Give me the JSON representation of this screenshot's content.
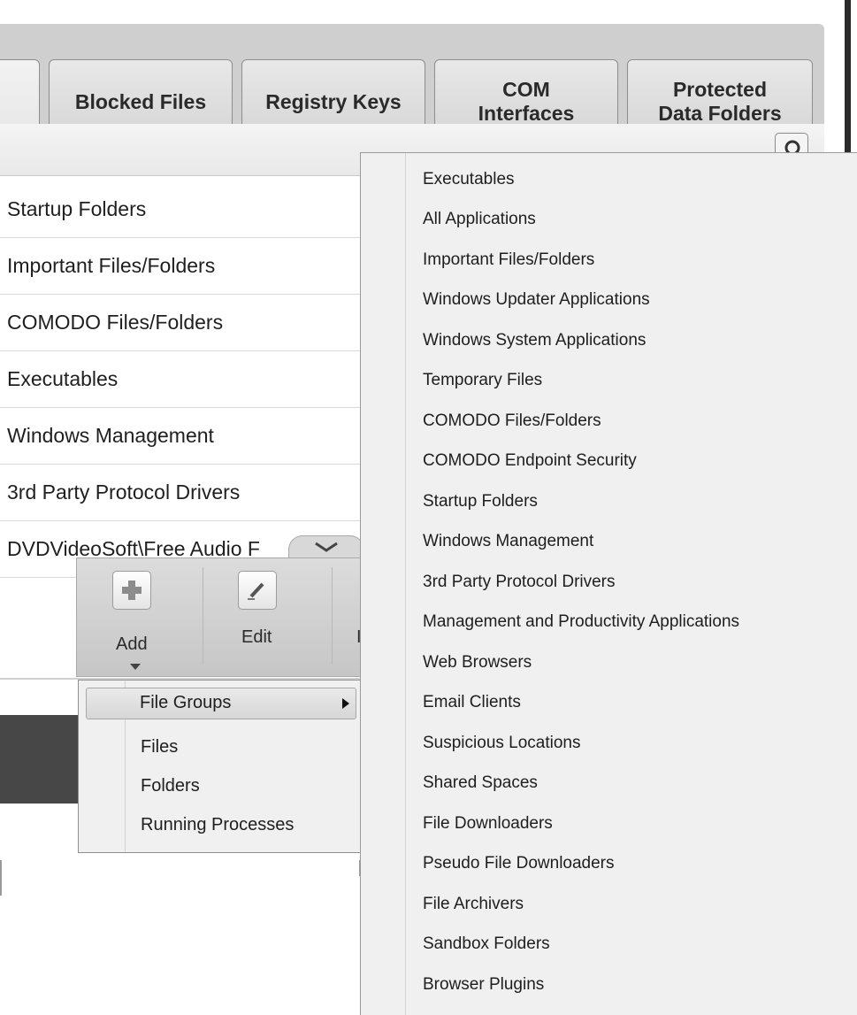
{
  "tabs": {
    "blocked_files": "Blocked Files",
    "registry_keys": "Registry Keys",
    "com_interfaces": "COM\nInterfaces",
    "protected_data_folders": "Protected\nData Folders"
  },
  "list": {
    "rows": [
      "Startup Folders",
      "Important Files/Folders",
      "COMODO Files/Folders",
      "Executables",
      "Windows Management",
      "3rd Party Protocol Drivers",
      "DVDVideoSoft\\Free Audio F"
    ]
  },
  "toolbar": {
    "add_label": "Add",
    "edit_label": "Edit",
    "partial_label": "I"
  },
  "add_menu": {
    "items": [
      "File Groups",
      "Files",
      "Folders",
      "Running Processes"
    ]
  },
  "file_groups_menu": {
    "items": [
      "Executables",
      "All Applications",
      "Important Files/Folders",
      "Windows Updater Applications",
      "Windows System Applications",
      "Temporary Files",
      "COMODO Files/Folders",
      "COMODO Endpoint Security",
      "Startup Folders",
      "Windows Management",
      "3rd Party Protocol Drivers",
      "Management and Productivity Applications",
      "Web Browsers",
      "Email Clients",
      "Suspicious Locations",
      "Shared Spaces",
      "File Downloaders",
      "Pseudo File Downloaders",
      "File Archivers",
      "Sandbox Folders",
      "Browser Plugins"
    ]
  },
  "icons": {
    "search": "search-icon",
    "add": "plus-icon",
    "edit": "pencil-icon",
    "submenu_arrow": "chevron-right-icon",
    "dropdown": "caret-down-icon",
    "collapse": "chevron-down-icon"
  }
}
